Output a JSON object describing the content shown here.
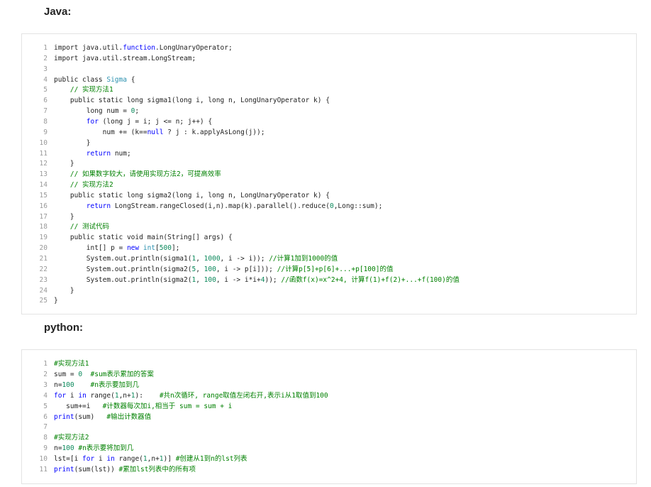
{
  "sections": [
    {
      "heading": "Java:",
      "lines": [
        [
          {
            "t": "import java.util.",
            "c": "plain"
          },
          {
            "t": "function",
            "c": "kw"
          },
          {
            "t": ".LongUnaryOperator;",
            "c": "plain"
          }
        ],
        [
          {
            "t": "import java.util.stream.LongStream;",
            "c": "plain"
          }
        ],
        [],
        [
          {
            "t": "public class ",
            "c": "plain"
          },
          {
            "t": "Sigma",
            "c": "ty"
          },
          {
            "t": " {",
            "c": "plain"
          }
        ],
        [
          {
            "t": "    // 实现方法1",
            "c": "cm"
          }
        ],
        [
          {
            "t": "    public static long sigma1(long i, long n, LongUnaryOperator k) {",
            "c": "plain"
          }
        ],
        [
          {
            "t": "        long num = ",
            "c": "plain"
          },
          {
            "t": "0",
            "c": "num"
          },
          {
            "t": ";",
            "c": "plain"
          }
        ],
        [
          {
            "t": "        ",
            "c": "plain"
          },
          {
            "t": "for",
            "c": "kw"
          },
          {
            "t": " (long j = i; j <= n; j++) {",
            "c": "plain"
          }
        ],
        [
          {
            "t": "            num += (k==",
            "c": "plain"
          },
          {
            "t": "null",
            "c": "kw"
          },
          {
            "t": " ? j : k.applyAsLong(j));",
            "c": "plain"
          }
        ],
        [
          {
            "t": "        }",
            "c": "plain"
          }
        ],
        [
          {
            "t": "        ",
            "c": "plain"
          },
          {
            "t": "return",
            "c": "kw"
          },
          {
            "t": " num;",
            "c": "plain"
          }
        ],
        [
          {
            "t": "    }",
            "c": "plain"
          }
        ],
        [
          {
            "t": "    // 如果数字较大，请使用实现方法2，可提高效率",
            "c": "cm"
          }
        ],
        [
          {
            "t": "    // 实现方法2",
            "c": "cm"
          }
        ],
        [
          {
            "t": "    public static long sigma2(long i, long n, LongUnaryOperator k) {",
            "c": "plain"
          }
        ],
        [
          {
            "t": "        ",
            "c": "plain"
          },
          {
            "t": "return",
            "c": "kw"
          },
          {
            "t": " LongStream.rangeClosed(i,n).map(k).parallel().reduce(",
            "c": "plain"
          },
          {
            "t": "0",
            "c": "num"
          },
          {
            "t": ",Long::sum);",
            "c": "plain"
          }
        ],
        [
          {
            "t": "    }",
            "c": "plain"
          }
        ],
        [
          {
            "t": "    // 测试代码",
            "c": "cm"
          }
        ],
        [
          {
            "t": "    public static void main(String[] args) {",
            "c": "plain"
          }
        ],
        [
          {
            "t": "        int[] p = ",
            "c": "plain"
          },
          {
            "t": "new",
            "c": "kw"
          },
          {
            "t": " ",
            "c": "plain"
          },
          {
            "t": "int",
            "c": "ty"
          },
          {
            "t": "[",
            "c": "plain"
          },
          {
            "t": "500",
            "c": "num"
          },
          {
            "t": "];",
            "c": "plain"
          }
        ],
        [
          {
            "t": "        System.out.println(sigma1(",
            "c": "plain"
          },
          {
            "t": "1",
            "c": "num"
          },
          {
            "t": ", ",
            "c": "plain"
          },
          {
            "t": "1000",
            "c": "num"
          },
          {
            "t": ", i -> i)); ",
            "c": "plain"
          },
          {
            "t": "//计算1加到1000的值",
            "c": "cm"
          }
        ],
        [
          {
            "t": "        System.out.println(sigma2(",
            "c": "plain"
          },
          {
            "t": "5",
            "c": "num"
          },
          {
            "t": ", ",
            "c": "plain"
          },
          {
            "t": "100",
            "c": "num"
          },
          {
            "t": ", i -> p[i])); ",
            "c": "plain"
          },
          {
            "t": "//计算p[5]+p[6]+...+p[100]的值",
            "c": "cm"
          }
        ],
        [
          {
            "t": "        System.out.println(sigma2(",
            "c": "plain"
          },
          {
            "t": "1",
            "c": "num"
          },
          {
            "t": ", ",
            "c": "plain"
          },
          {
            "t": "100",
            "c": "num"
          },
          {
            "t": ", i -> i*i+",
            "c": "plain"
          },
          {
            "t": "4",
            "c": "num"
          },
          {
            "t": ")); ",
            "c": "plain"
          },
          {
            "t": "//函数f(x)=x^2+4, 计算f(1)+f(2)+...+f(100)的值",
            "c": "cm"
          }
        ],
        [
          {
            "t": "    }",
            "c": "plain"
          }
        ],
        [
          {
            "t": "}",
            "c": "plain"
          }
        ]
      ]
    },
    {
      "heading": "python:",
      "lines": [
        [
          {
            "t": "#实现方法1",
            "c": "cm"
          }
        ],
        [
          {
            "t": "sum = ",
            "c": "plain"
          },
          {
            "t": "0",
            "c": "num"
          },
          {
            "t": "  ",
            "c": "plain"
          },
          {
            "t": "#sum表示累加的答案",
            "c": "cm"
          }
        ],
        [
          {
            "t": "n=",
            "c": "plain"
          },
          {
            "t": "100",
            "c": "num"
          },
          {
            "t": "    ",
            "c": "plain"
          },
          {
            "t": "#n表示要加到几",
            "c": "cm"
          }
        ],
        [
          {
            "t": "for",
            "c": "kw"
          },
          {
            "t": " i ",
            "c": "plain"
          },
          {
            "t": "in",
            "c": "kw"
          },
          {
            "t": " range(",
            "c": "plain"
          },
          {
            "t": "1",
            "c": "num"
          },
          {
            "t": ",n+",
            "c": "plain"
          },
          {
            "t": "1",
            "c": "num"
          },
          {
            "t": "):    ",
            "c": "plain"
          },
          {
            "t": "#共n次循环, range取值左闭右开,表示i从1取值到100",
            "c": "cm"
          }
        ],
        [
          {
            "t": "   sum+=i   ",
            "c": "plain"
          },
          {
            "t": "#计数器每次加i,相当于 sum = sum + i",
            "c": "cm"
          }
        ],
        [
          {
            "t": "print",
            "c": "kw"
          },
          {
            "t": "(sum)   ",
            "c": "plain"
          },
          {
            "t": "#输出计数器值",
            "c": "cm"
          }
        ],
        [],
        [
          {
            "t": "#实现方法2",
            "c": "cm"
          }
        ],
        [
          {
            "t": "n=",
            "c": "plain"
          },
          {
            "t": "100",
            "c": "num"
          },
          {
            "t": " ",
            "c": "plain"
          },
          {
            "t": "#n表示要将加到几",
            "c": "cm"
          }
        ],
        [
          {
            "t": "lst=[i ",
            "c": "plain"
          },
          {
            "t": "for",
            "c": "kw"
          },
          {
            "t": " i ",
            "c": "plain"
          },
          {
            "t": "in",
            "c": "kw"
          },
          {
            "t": " range(",
            "c": "plain"
          },
          {
            "t": "1",
            "c": "num"
          },
          {
            "t": ",n+",
            "c": "plain"
          },
          {
            "t": "1",
            "c": "num"
          },
          {
            "t": ")] ",
            "c": "plain"
          },
          {
            "t": "#创建从1到n的lst列表",
            "c": "cm"
          }
        ],
        [
          {
            "t": "print",
            "c": "kw"
          },
          {
            "t": "(sum(lst)) ",
            "c": "plain"
          },
          {
            "t": "#累加lst列表中的所有项",
            "c": "cm"
          }
        ]
      ]
    }
  ]
}
